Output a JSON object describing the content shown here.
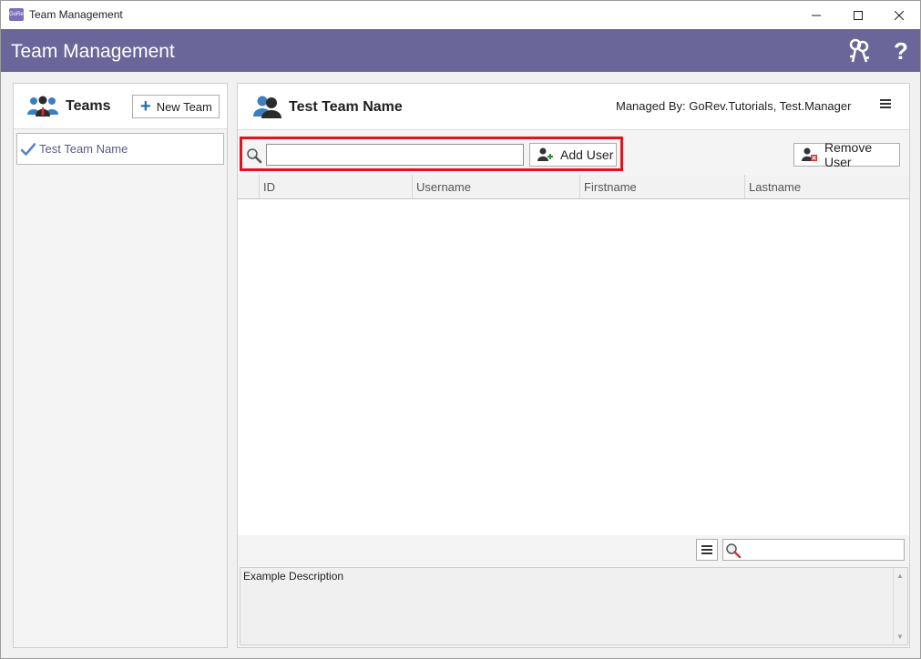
{
  "window": {
    "title": "Team Management",
    "app_icon_text": "GoRev"
  },
  "header": {
    "title": "Team Management",
    "icons": [
      "keys-icon",
      "help-icon"
    ],
    "help_glyph": "?",
    "background_color": "#6b6699"
  },
  "teams_panel": {
    "title": "Teams",
    "new_team_label": "New Team",
    "items": [
      {
        "label": "Test Team Name",
        "selected": true
      }
    ]
  },
  "team_detail": {
    "team_name": "Test Team Name",
    "managed_by": "Managed By: GoRev.Tutorials, Test.Manager",
    "user_search": {
      "value": "",
      "placeholder": ""
    },
    "add_user_label": "Add User",
    "remove_user_label": "Remove User",
    "columns": [
      "ID",
      "Username",
      "Firstname",
      "Lastname"
    ],
    "rows": [],
    "filter_search": {
      "value": "",
      "placeholder": ""
    },
    "description": "Example Description"
  },
  "colors": {
    "highlight": "#e0141e",
    "accent_blue": "#1f6fb5"
  }
}
